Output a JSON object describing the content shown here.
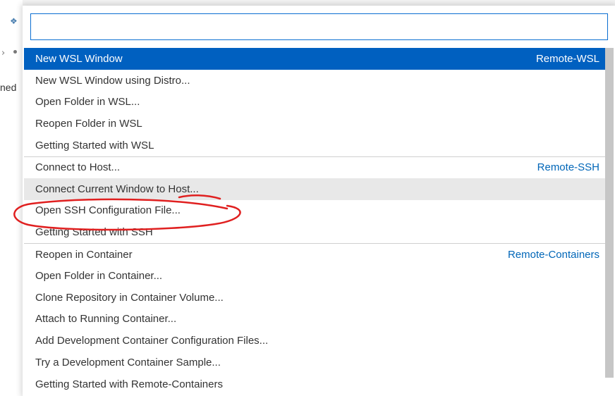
{
  "background": {
    "truncated_text": "ned"
  },
  "quick_pick": {
    "input_value": "",
    "items": [
      {
        "label": "New WSL Window",
        "group": "Remote-WSL"
      },
      {
        "label": "New WSL Window using Distro...",
        "group": ""
      },
      {
        "label": "Open Folder in WSL...",
        "group": ""
      },
      {
        "label": "Reopen Folder in WSL",
        "group": ""
      },
      {
        "label": "Getting Started with WSL",
        "group": ""
      },
      {
        "label": "Connect to Host...",
        "group": "Remote-SSH"
      },
      {
        "label": "Connect Current Window to Host...",
        "group": ""
      },
      {
        "label": "Open SSH Configuration File...",
        "group": ""
      },
      {
        "label": "Getting Started with SSH",
        "group": ""
      },
      {
        "label": "Reopen in Container",
        "group": "Remote-Containers"
      },
      {
        "label": "Open Folder in Container...",
        "group": ""
      },
      {
        "label": "Clone Repository in Container Volume...",
        "group": ""
      },
      {
        "label": "Attach to Running Container...",
        "group": ""
      },
      {
        "label": "Add Development Container Configuration Files...",
        "group": ""
      },
      {
        "label": "Try a Development Container Sample...",
        "group": ""
      },
      {
        "label": "Getting Started with Remote-Containers",
        "group": ""
      }
    ]
  },
  "colors": {
    "selected_bg": "#0060c0",
    "group_label": "#0066b8",
    "focus_border": "#0a6ed1",
    "annotation": "#e02020"
  }
}
